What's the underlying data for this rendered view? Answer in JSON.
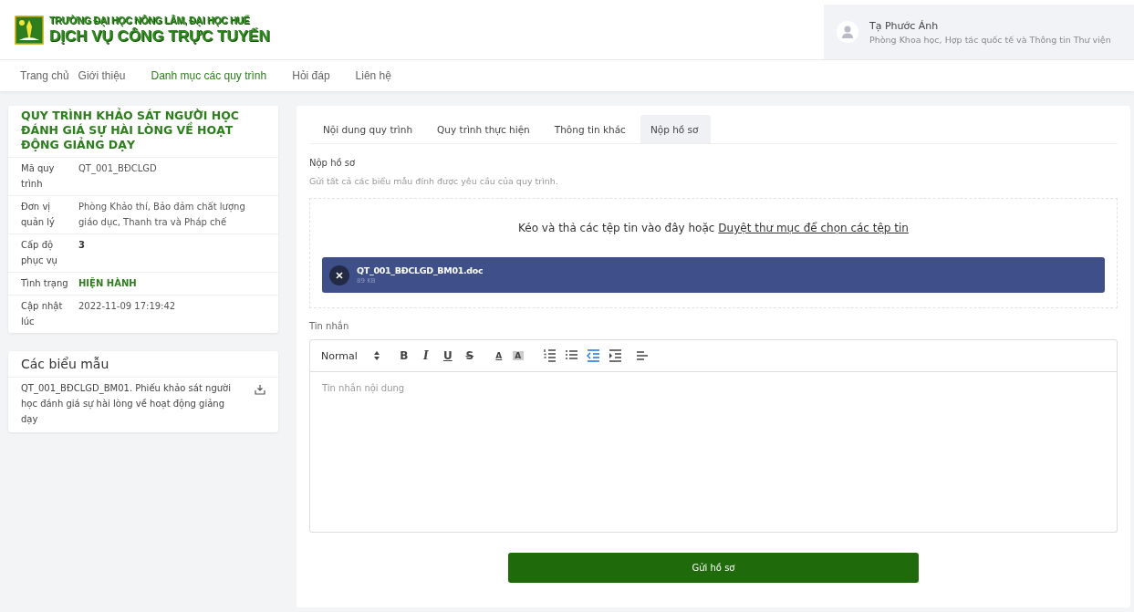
{
  "header": {
    "school": "TRƯỜNG ĐẠI HỌC NÔNG LÂM, ĐẠI HỌC HUẾ",
    "service": "DỊCH VỤ CÔNG TRỰC TUYẾN",
    "user": {
      "name": "Tạ Phước Ánh",
      "department": "Phòng Khoa học, Hợp tác quốc tế và Thông tin Thư viện"
    }
  },
  "nav": [
    {
      "label": "Trang chủ",
      "selected": false
    },
    {
      "label": "Giới thiệu",
      "selected": false
    },
    {
      "label": "Danh mục các quy trình",
      "selected": true
    },
    {
      "label": "Hỏi đáp",
      "selected": false
    },
    {
      "label": "Liên hệ",
      "selected": false
    }
  ],
  "process": {
    "title": "QUY TRÌNH KHẢO SÁT NGƯỜI HỌC ĐÁNH GIÁ SỰ HÀI LÒNG VỀ HOẠT ĐỘNG GIẢNG DẠY",
    "fields": [
      {
        "label": "Mã quy trình",
        "value": "QT_001_BĐCLGD",
        "kind": "plain"
      },
      {
        "label": "Đơn vị quản lý",
        "value": "Phòng Khảo thí, Bảo đảm chất lượng giáo dục, Thanh tra và Pháp chế",
        "kind": "plain"
      },
      {
        "label": "Cấp độ phục vụ",
        "value": "3",
        "kind": "bold"
      },
      {
        "label": "Tình trạng",
        "value": "HIỆN HÀNH",
        "kind": "status"
      },
      {
        "label": "Cập nhật lúc",
        "value": "2022-11-09 17:19:42",
        "kind": "plain"
      }
    ]
  },
  "forms": {
    "title": "Các biểu mẫu",
    "items": [
      {
        "name": "QT_001_BĐCLGD_BM01. Phiếu khảo sát người học đánh giá sự hài lòng về hoạt động giảng dạy"
      }
    ]
  },
  "tabs": [
    {
      "label": "Nội dung quy trình",
      "selected": false
    },
    {
      "label": "Quy trình thực hiện",
      "selected": false
    },
    {
      "label": "Thông tin khác",
      "selected": false
    },
    {
      "label": "Nộp hồ sơ",
      "selected": true
    }
  ],
  "submit": {
    "heading": "Nộp hồ sơ",
    "description": "Gửi tất cả các biểu mẫu đính được yêu cầu của quy trình.",
    "dropzone": {
      "text": "Kéo và thả các tệp tin vào đây hoặc",
      "link": "Duyệt thư mục để chọn các tệp tin"
    },
    "files": [
      {
        "name": "QT_001_BĐCLGD_BM01.doc",
        "size": "89 KB"
      }
    ],
    "message_label": "Tin nhắn",
    "toolbar": [
      {
        "kind": "select",
        "label": "Normal"
      },
      {
        "kind": "bold",
        "label": "B",
        "active": false
      },
      {
        "kind": "italic",
        "label": "I",
        "active": false
      },
      {
        "kind": "underline",
        "label": "U",
        "active": false
      },
      {
        "kind": "strike",
        "label": "S",
        "active": false
      },
      {
        "kind": "color",
        "label": "A",
        "active": false
      },
      {
        "kind": "background",
        "label": "A",
        "active": false
      },
      {
        "kind": "ordered-list",
        "active": false
      },
      {
        "kind": "bullet-list",
        "active": false
      },
      {
        "kind": "outdent",
        "active": true
      },
      {
        "kind": "indent",
        "active": false
      },
      {
        "kind": "align",
        "active": false
      }
    ],
    "message_placeholder": "Tin nhắn nội dung",
    "button": "Gửi hồ sơ"
  }
}
